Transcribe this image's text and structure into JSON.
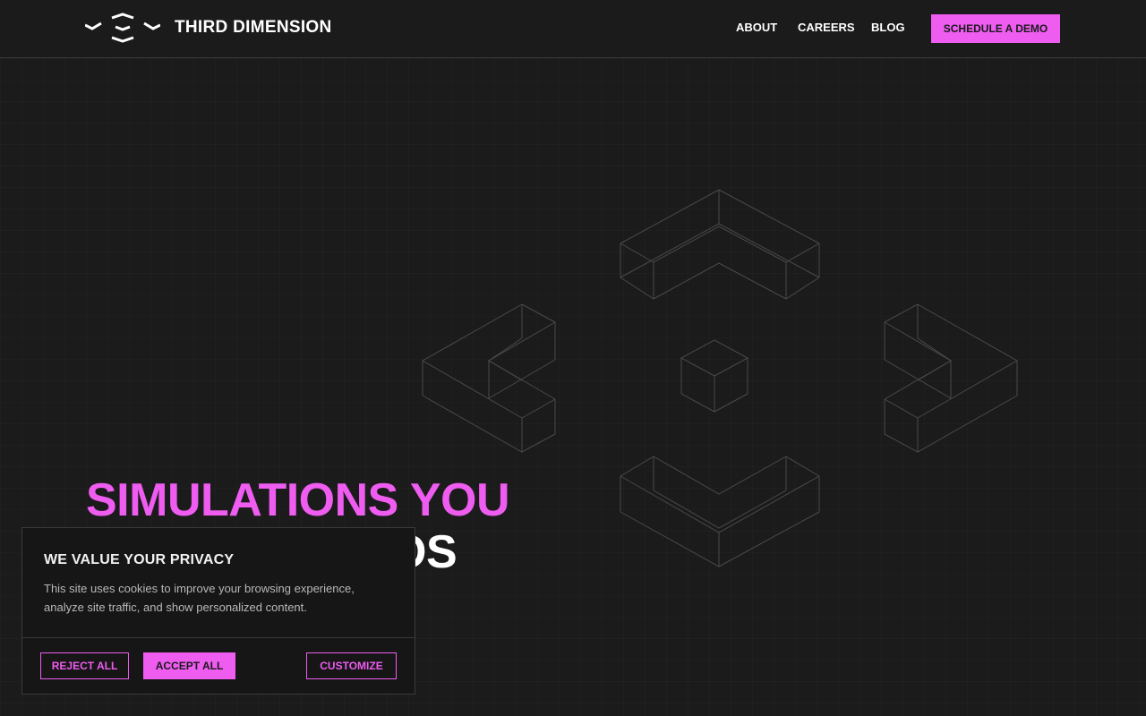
{
  "header": {
    "brand": "THIRD DIMENSION",
    "nav": [
      {
        "label": "ABOUT"
      },
      {
        "label": "CAREERS"
      },
      {
        "label": "BLOG"
      }
    ],
    "cta_label": "SCHEDULE A DEMO"
  },
  "hero": {
    "title_line1": "SIMULATIONS YOU",
    "title_line2": "OS"
  },
  "cookie_banner": {
    "title": "WE VALUE YOUR PRIVACY",
    "text": "This site uses cookies to improve your browsing experience, analyze site traffic, and show personalized content.",
    "reject_label": "REJECT ALL",
    "accept_label": "ACCEPT ALL",
    "customize_label": "CUSTOMIZE"
  },
  "colors": {
    "accent": "#ee5cf0",
    "background": "#1b1b1b",
    "panel": "#161616"
  },
  "icons": {
    "logo": "third-dimension-logo-icon"
  }
}
